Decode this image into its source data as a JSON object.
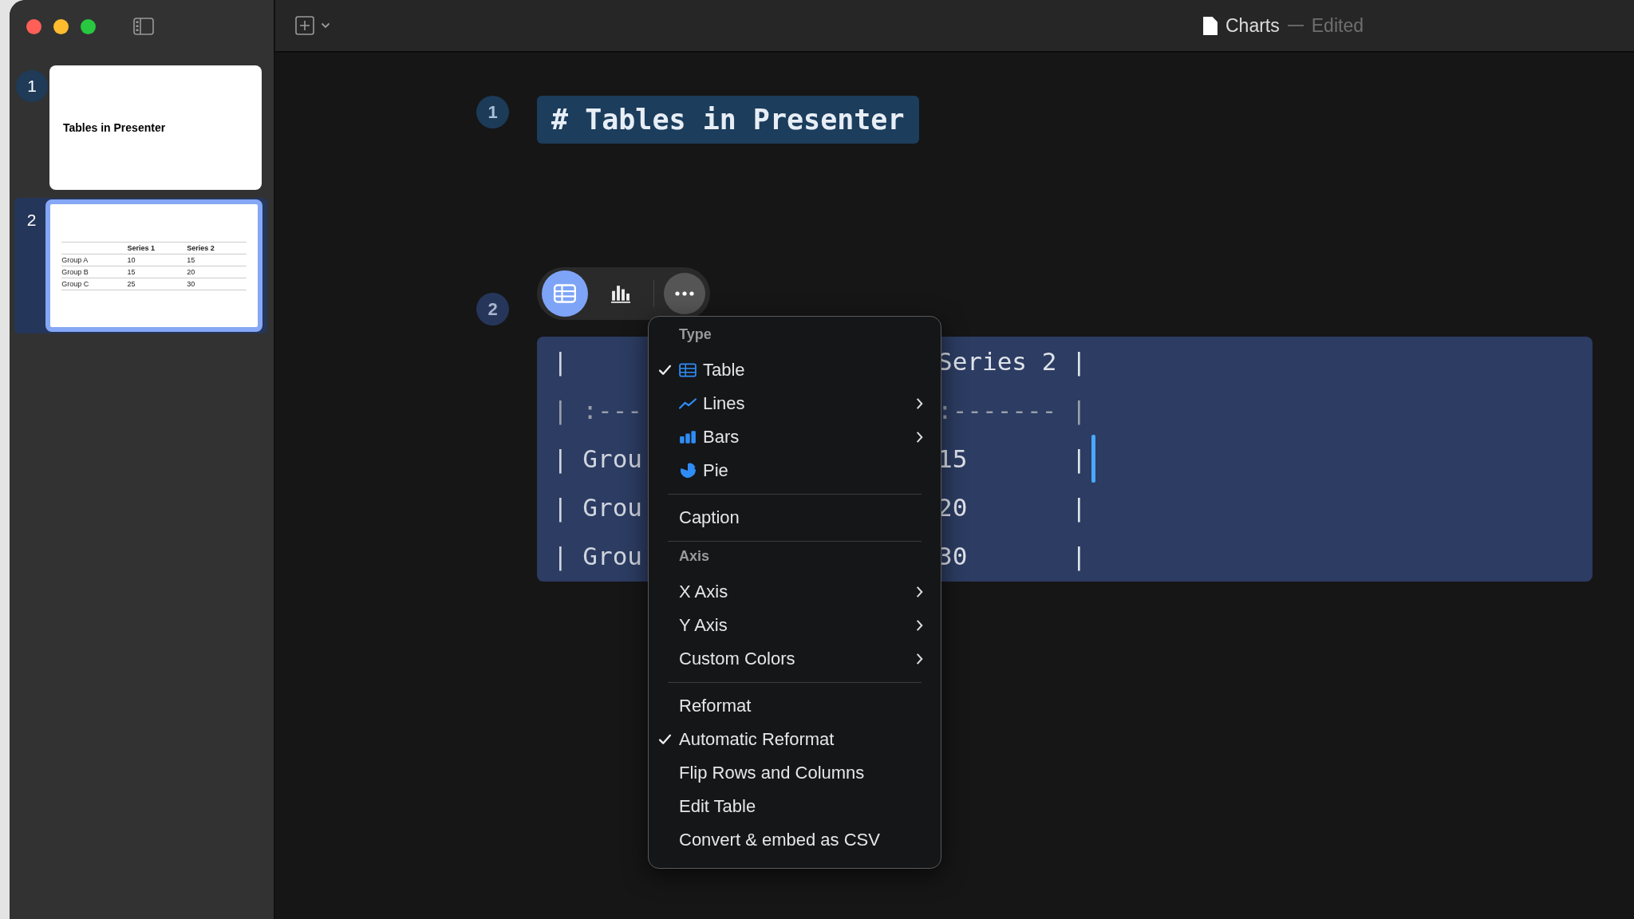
{
  "window": {
    "title": "Charts",
    "status": "Edited"
  },
  "slides": [
    {
      "number": "1",
      "selected": false,
      "kind": "title",
      "title": "Tables in Presenter"
    },
    {
      "number": "2",
      "selected": true,
      "kind": "table",
      "columns": [
        "",
        "Series 1",
        "Series 2"
      ],
      "rows": [
        [
          "Group A",
          "10",
          "15"
        ],
        [
          "Group B",
          "15",
          "20"
        ],
        [
          "Group C",
          "25",
          "30"
        ]
      ]
    }
  ],
  "editor": {
    "blocks": [
      {
        "number": "1",
        "kind": "heading",
        "text": "# Tables in Presenter"
      },
      {
        "number": "2",
        "kind": "table",
        "toolbar": [
          {
            "kind": "table",
            "selected": true
          },
          {
            "kind": "bars",
            "selected": false
          },
          {
            "kind": "more",
            "selected": false
          }
        ],
        "lines": [
          {
            "left": "|",
            "right": "Series 2 |",
            "cursor": false,
            "kind": "text"
          },
          {
            "left": "| :---",
            "right": ":------- |",
            "cursor": false,
            "kind": "rule"
          },
          {
            "left": "| Grou",
            "right": "15       |",
            "cursor": true,
            "kind": "text"
          },
          {
            "left": "| Grou",
            "right": "20       |",
            "cursor": false,
            "kind": "text"
          },
          {
            "left": "| Grou",
            "right": "30       |",
            "cursor": false,
            "kind": "text"
          }
        ]
      }
    ]
  },
  "menu": {
    "sections": [
      {
        "header": "Type",
        "items": [
          {
            "label": "Table",
            "kind": "table",
            "checked": true,
            "submenu": false
          },
          {
            "label": "Lines",
            "kind": "lines",
            "checked": false,
            "submenu": true
          },
          {
            "label": "Bars",
            "kind": "bars",
            "checked": false,
            "submenu": true
          },
          {
            "label": "Pie",
            "kind": "pie",
            "checked": false,
            "submenu": false
          }
        ]
      },
      {
        "items": [
          {
            "label": "Caption",
            "kind": "plain",
            "checked": false,
            "submenu": false
          }
        ]
      },
      {
        "header": "Axis",
        "items": [
          {
            "label": "X Axis",
            "kind": "plain",
            "checked": false,
            "submenu": true
          },
          {
            "label": "Y Axis",
            "kind": "plain",
            "checked": false,
            "submenu": true
          },
          {
            "label": "Custom Colors",
            "kind": "plain",
            "checked": false,
            "submenu": true
          }
        ]
      },
      {
        "items": [
          {
            "label": "Reformat",
            "kind": "plain",
            "checked": false,
            "submenu": false
          },
          {
            "label": "Automatic Reformat",
            "kind": "plain",
            "checked": true,
            "submenu": false
          },
          {
            "label": "Flip Rows and Columns",
            "kind": "plain",
            "checked": false,
            "submenu": false
          },
          {
            "label": "Edit Table",
            "kind": "plain",
            "checked": false,
            "submenu": false
          },
          {
            "label": "Convert & embed as CSV",
            "kind": "plain",
            "checked": false,
            "submenu": false
          }
        ]
      }
    ]
  }
}
